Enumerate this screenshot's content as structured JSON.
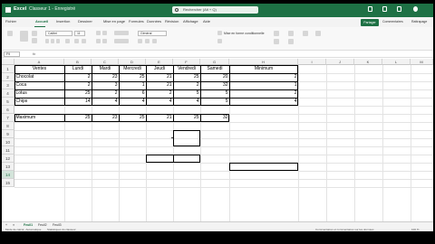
{
  "titlebar": {
    "app_name": "Excel",
    "doc_name": "Classeur 1 - Enregistré",
    "search_placeholder": "Rechercher (Alt + Q)"
  },
  "menu": {
    "items": [
      "Fichier",
      "Accueil",
      "Insertion",
      "Dessiner",
      "Mise en page",
      "Formules",
      "Données",
      "Révision",
      "Affichage",
      "Aide"
    ],
    "share": "Partager",
    "comments": "Commentaires",
    "catch_up": "Rattrapage"
  },
  "ribbon": {
    "font_name": "Calibri",
    "font_size": "11",
    "number_format": "Général",
    "conditional_format": "Mise en forme conditionnelle"
  },
  "formula_bar": {
    "name_box": "F9",
    "fx": "fx"
  },
  "columns": [
    "A",
    "B",
    "C",
    "D",
    "E",
    "F",
    "G",
    "H",
    "I",
    "J",
    "K",
    "L",
    "M"
  ],
  "rows": [
    "1",
    "2",
    "3",
    "4",
    "5",
    "6",
    "7",
    "8",
    "9",
    "10",
    "11",
    "12",
    "13",
    "14",
    "15"
  ],
  "selected_row": "14",
  "table": {
    "headers": [
      "Ventes",
      "Lundi",
      "Mardi",
      "Mercredi",
      "Jeudi",
      "Vendredi",
      "Samedi",
      "Minimum"
    ],
    "rows": [
      {
        "label": "Chocolat",
        "values": [
          "2",
          "23",
          "25",
          "21",
          "25",
          "20"
        ],
        "min": "2"
      },
      {
        "label": "Coca",
        "values": [
          "2",
          "3",
          "1",
          "21",
          "2",
          "32"
        ],
        "min": "1"
      },
      {
        "label": "Lotus",
        "values": [
          "25",
          "2",
          "6",
          "2",
          "5",
          "5"
        ],
        "min": "2"
      },
      {
        "label": "Chips",
        "values": [
          "14",
          "4",
          "4",
          "4",
          "4",
          "5"
        ],
        "min": "4"
      }
    ],
    "max_label": "Maximum",
    "max_values": [
      "25",
      "23",
      "25",
      "21",
      "25",
      "32"
    ]
  },
  "sheets": [
    "Feuil1",
    "Feuil2",
    "Feuil3"
  ],
  "active_sheet": "Feuil1",
  "status": {
    "left": "Mode de calcul : Automatique",
    "stats": "Statistiques du classeur",
    "right": "Commentaires et commentaires sur les données",
    "zoom": "100 %"
  },
  "colors": {
    "accent": "#1e7145"
  }
}
